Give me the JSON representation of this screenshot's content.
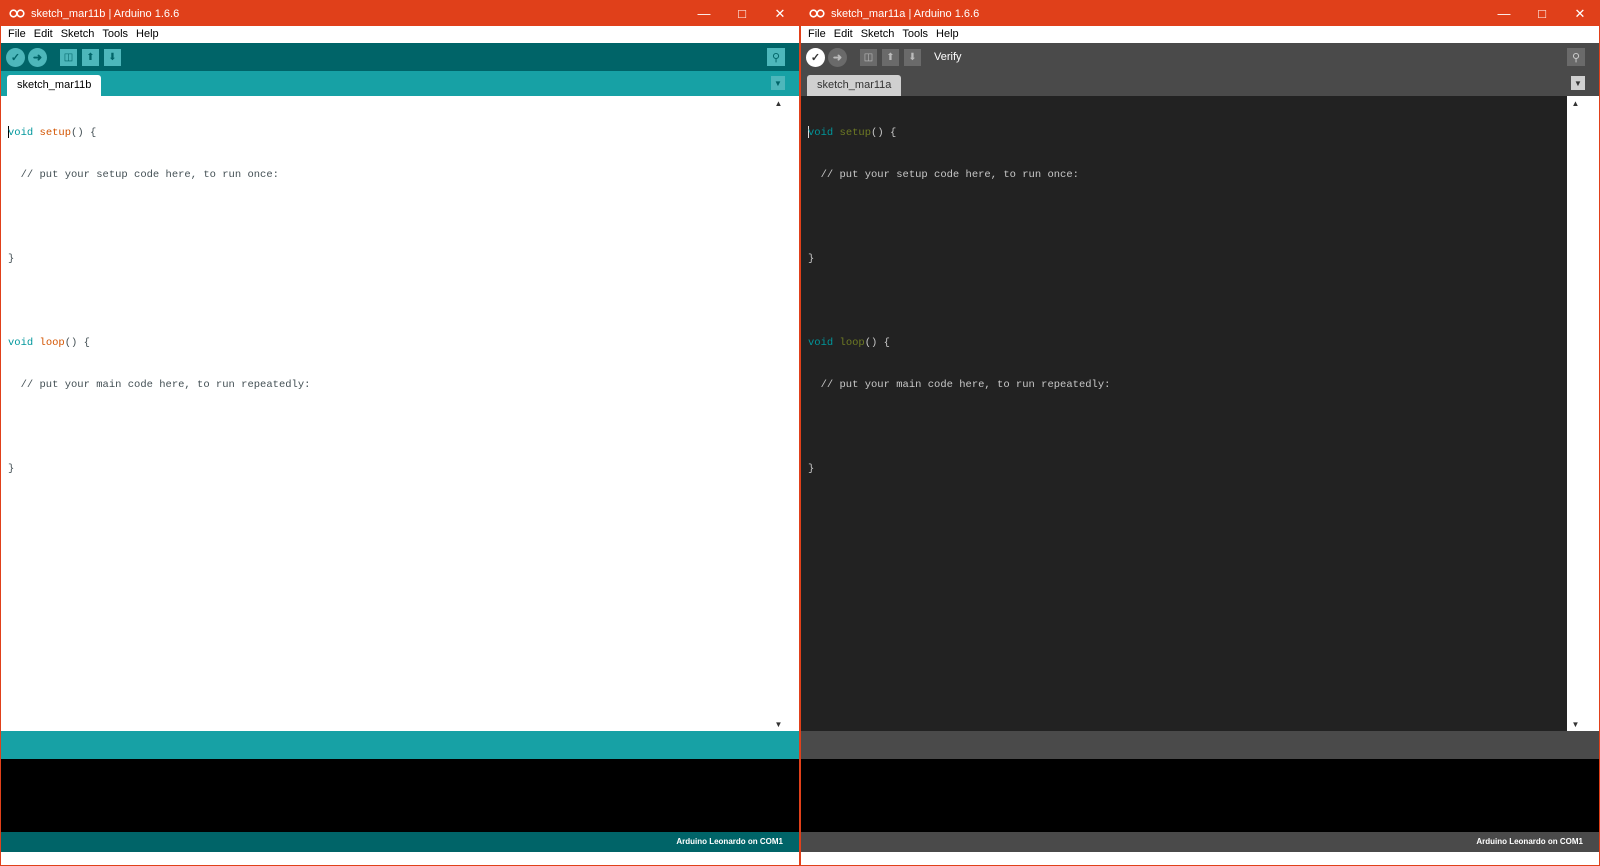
{
  "windows": [
    {
      "title": "sketch_mar11b | Arduino 1.6.6",
      "menu": [
        "File",
        "Edit",
        "Sketch",
        "Tools",
        "Help"
      ],
      "toolbar_status": "",
      "tab_label": "sketch_mar11b",
      "status_text": "Arduino Leonardo on COM1",
      "theme": "light"
    },
    {
      "title": "sketch_mar11a | Arduino 1.6.6",
      "menu": [
        "File",
        "Edit",
        "Sketch",
        "Tools",
        "Help"
      ],
      "toolbar_status": "Verify",
      "tab_label": "sketch_mar11a",
      "status_text": "Arduino Leonardo on COM1",
      "theme": "dark"
    }
  ],
  "code": {
    "setup_kw": "void",
    "setup_fn": "setup",
    "setup_rest": "() {",
    "setup_comment": "  // put your setup code here, to run once:",
    "close_brace": "}",
    "loop_kw": "void",
    "loop_fn": "loop",
    "loop_rest": "() {",
    "loop_comment": "  // put your main code here, to run repeatedly:"
  },
  "icons": {
    "window_controls": [
      "minimize-icon",
      "maximize-icon",
      "close-icon"
    ],
    "toolbar": [
      "verify-icon",
      "upload-icon",
      "new-icon",
      "open-icon",
      "save-icon",
      "serial-monitor-icon"
    ]
  },
  "colors": {
    "titlebar": "#e0401a",
    "teal_dark": "#006468",
    "teal": "#17a1a5",
    "dark_bg": "#222222",
    "dark_toolbar": "#4a4a4a"
  }
}
